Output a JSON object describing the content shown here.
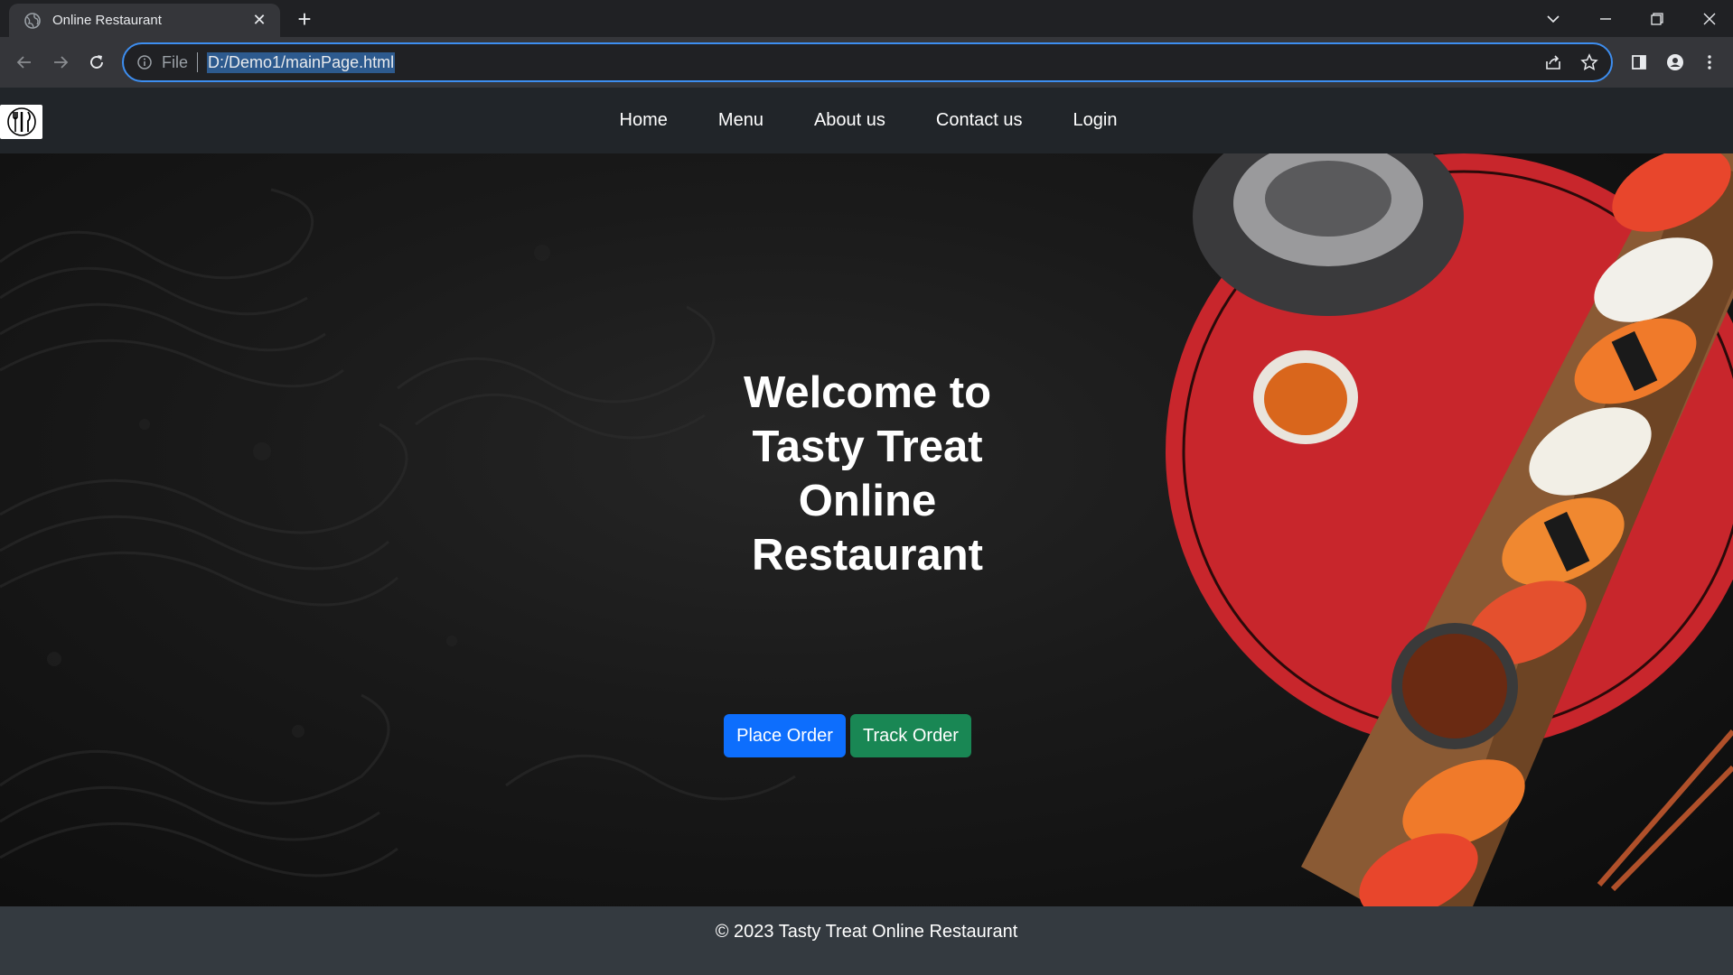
{
  "browser": {
    "tab_title": "Online Restaurant",
    "url_scheme": "File",
    "url": "D:/Demo1/mainPage.html"
  },
  "nav": {
    "links": [
      "Home",
      "Menu",
      "About us",
      "Contact us",
      "Login"
    ]
  },
  "hero": {
    "title_lines": [
      "Welcome to",
      "Tasty Treat",
      "Online",
      "Restaurant"
    ],
    "place_order_label": "Place Order",
    "track_order_label": "Track Order"
  },
  "footer": {
    "text": "© 2023 Tasty Treat Online Restaurant"
  },
  "colors": {
    "primary_button": "#0d6efd",
    "success_button": "#198754",
    "navbar": "#212529",
    "footer": "#343a40"
  }
}
